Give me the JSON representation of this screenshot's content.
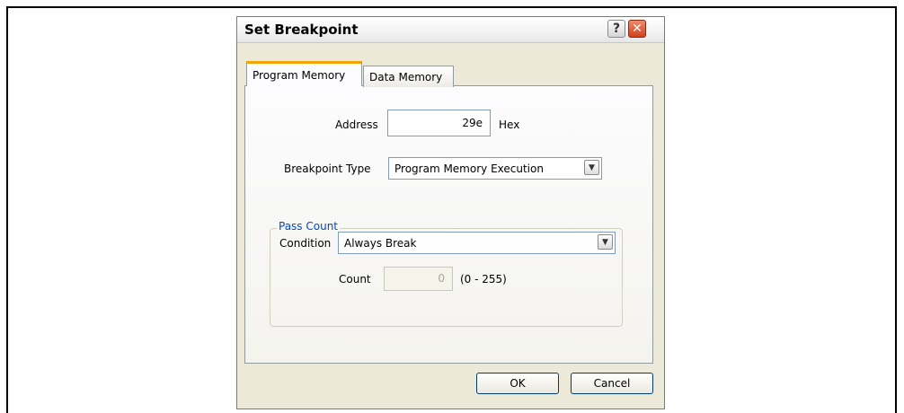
{
  "dialog": {
    "title": "Set Breakpoint",
    "help_icon": "?",
    "close_icon": "✕"
  },
  "tabs": [
    {
      "label": "Program Memory",
      "active": true
    },
    {
      "label": "Data Memory",
      "active": false
    }
  ],
  "address": {
    "label": "Address",
    "value": "29e",
    "unit": "Hex"
  },
  "breakpoint_type": {
    "label": "Breakpoint Type",
    "value": "Program Memory Execution"
  },
  "pass_count": {
    "title": "Pass Count",
    "condition_label": "Condition",
    "condition_value": "Always Break",
    "count_label": "Count",
    "count_value": "0",
    "count_range": "(0 - 255)"
  },
  "buttons": {
    "ok": "OK",
    "cancel": "Cancel"
  },
  "icons": {
    "dropdown": "chevron-down-icon",
    "help": "help-icon",
    "close": "close-icon"
  },
  "colors": {
    "active_tab_accent": "#f4a300",
    "group_title": "#0046d5",
    "close_button": "#d2401e"
  }
}
